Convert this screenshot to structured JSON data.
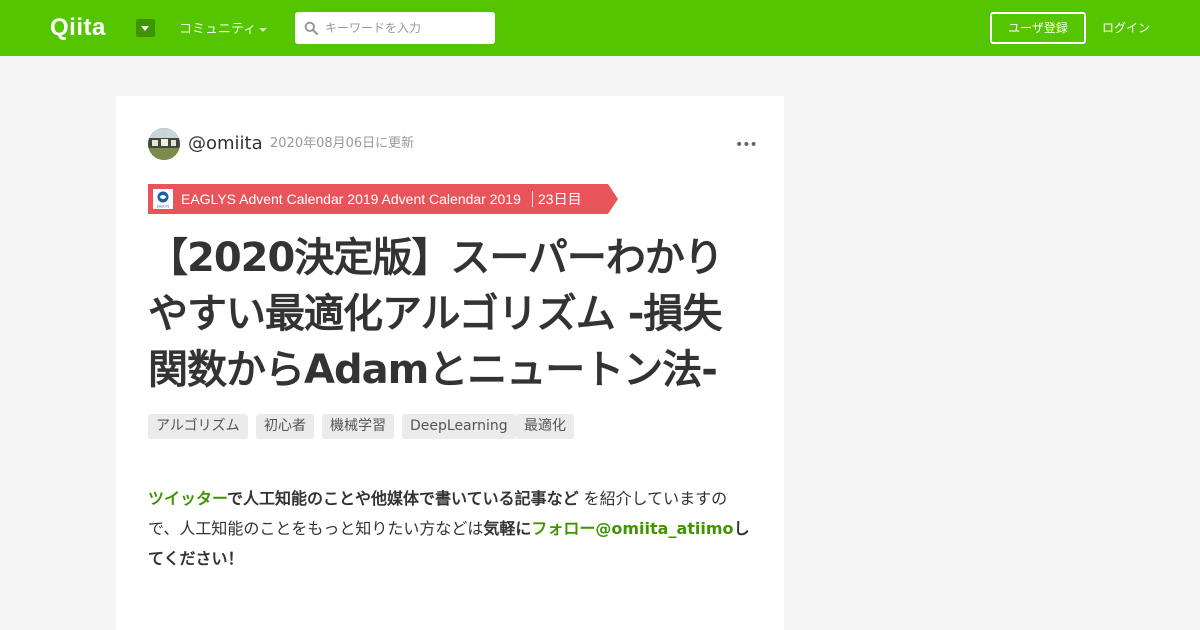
{
  "header": {
    "logo_text": "Qiita",
    "community_label": "コミュニティ",
    "search": {
      "placeholder": "キーワードを入力"
    },
    "signup_label": "ユーザ登録",
    "login_label": "ログイン"
  },
  "article": {
    "author": "@omiita",
    "updated": "2020年08月06日に更新",
    "more_label": "•••",
    "calendar": {
      "name": "EAGLYS Advent Calendar 2019 Advent Calendar 2019",
      "day": "23日目",
      "logo_text": "EAGLYS"
    },
    "title_lines": [
      "【2020決定版】スーパーわかり",
      "やすい最適化アルゴリズム -損失",
      "関数からAdamとニュートン法-"
    ],
    "tags": [
      "アルゴリズム",
      "初心者",
      "機械学習",
      "DeepLearning",
      "最適化"
    ],
    "intro": {
      "link1": "ツイッター",
      "bold1": "で人工知能のことや他媒体で書いている記事など",
      "text1": " を紹介していますので、人工知能のことをもっと知りたい方などは",
      "bold2": "気軽に",
      "link2": "フォロー@omiita_atiimo",
      "bold3": "してください！"
    }
  },
  "colors": {
    "brand_green": "#55c500",
    "link_green": "#3f9400",
    "ribbon_red": "#e9545a"
  }
}
